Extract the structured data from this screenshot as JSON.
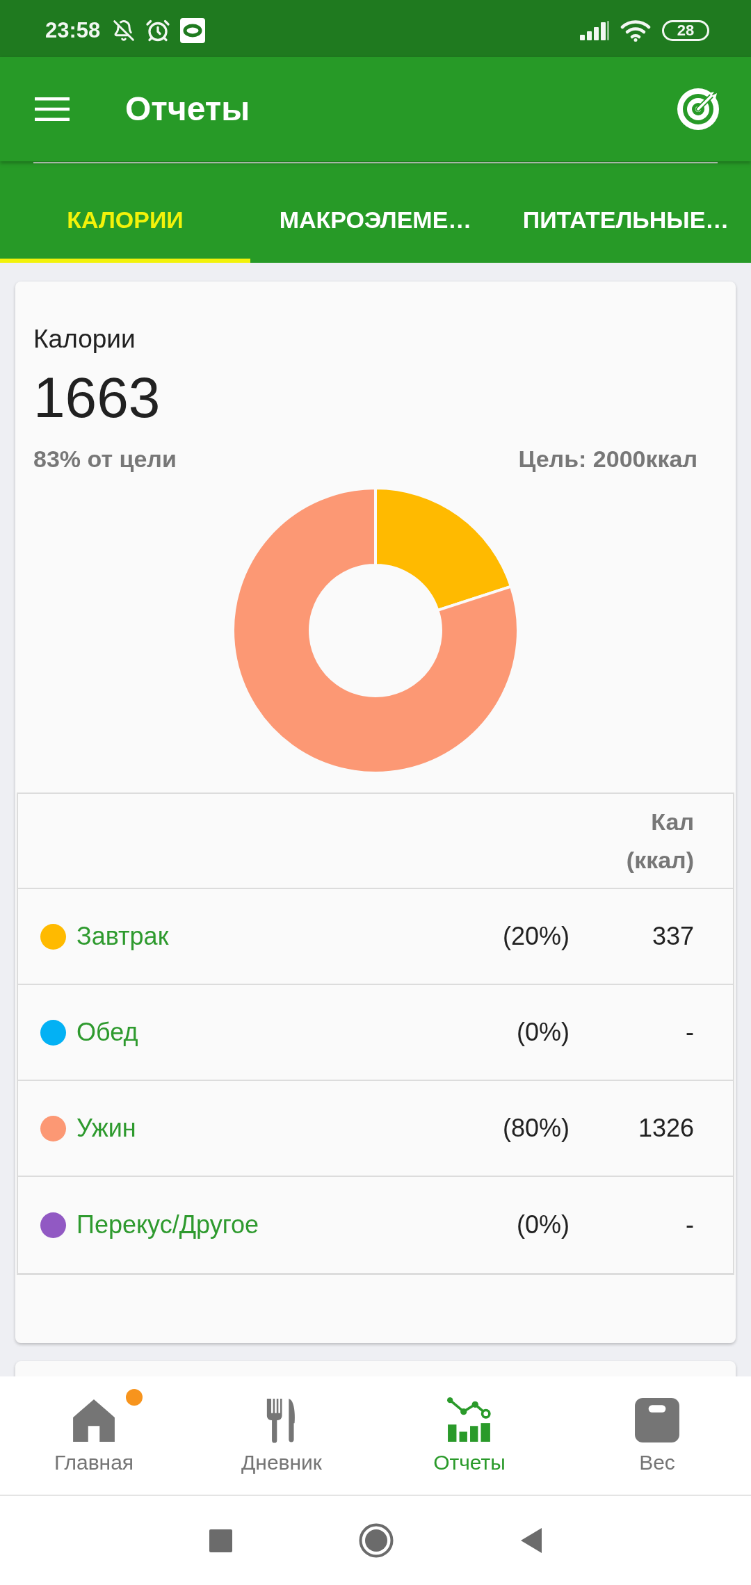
{
  "status_bar": {
    "time": "23:58",
    "battery": "28"
  },
  "app_bar": {
    "title": "Отчеты"
  },
  "tabs": [
    {
      "label": "КАЛОРИИ",
      "selected": true
    },
    {
      "label": "МАКРОЭЛЕМЕ…",
      "selected": false
    },
    {
      "label": "ПИТАТЕЛЬНЫЕ…",
      "selected": false
    }
  ],
  "summary": {
    "label": "Калории",
    "value": "1663",
    "percent_of_goal": "83% от цели",
    "goal": "Цель: 2000ккал",
    "chart_data": {
      "type": "donut",
      "values": [
        20,
        0,
        80,
        0
      ]
    }
  },
  "table": {
    "header": "Кал (ккал)",
    "rows": [
      {
        "name": "Завтрак",
        "color": "#ffba00",
        "share": "(20%)",
        "calories": "337"
      },
      {
        "name": "Обед",
        "color": "#03b1f4",
        "share": "(0%)",
        "calories": "-"
      },
      {
        "name": "Ужин",
        "color": "#fc9874",
        "share": "(80%)",
        "calories": "1326"
      },
      {
        "name": "Перекус/Другое",
        "color": "#9159c3",
        "share": "(0%)",
        "calories": "-"
      }
    ]
  },
  "bottom_nav": [
    {
      "label": "Главная",
      "selected": false,
      "notification": true
    },
    {
      "label": "Дневник",
      "selected": false,
      "notification": false
    },
    {
      "label": "Отчеты",
      "selected": true,
      "notification": false
    },
    {
      "label": "Вес",
      "selected": false,
      "notification": false
    }
  ]
}
